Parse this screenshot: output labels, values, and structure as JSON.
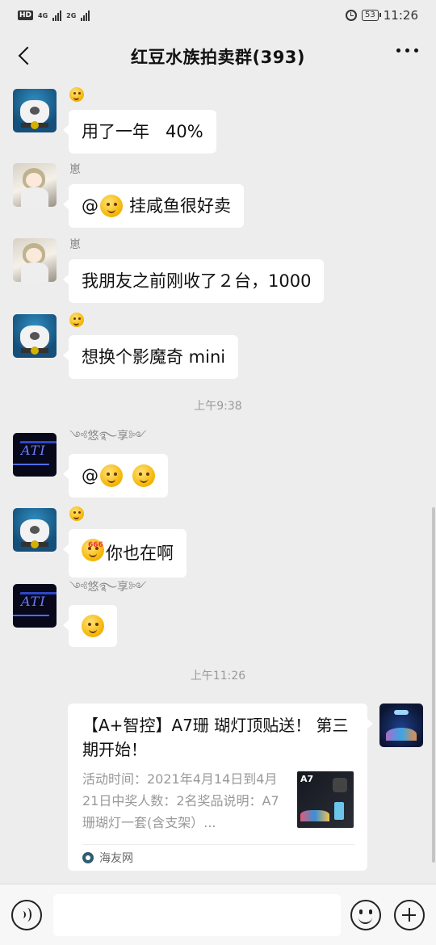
{
  "status_bar": {
    "network_badge": "HD",
    "signal1_label": "4G",
    "signal2_label": "2G",
    "battery": "53",
    "time": "11:26"
  },
  "header": {
    "title": "红豆水族拍卖群(393)"
  },
  "messages": [
    {
      "sender_icon": "thinking-emoji",
      "text": "用了一年   40%"
    },
    {
      "sender": "崽",
      "text": "挂咸鱼很好卖",
      "prefix": "@"
    },
    {
      "sender": "崽",
      "text": "我朋友之前刚收了２台，1000"
    },
    {
      "sender_icon": "thinking-emoji",
      "text": "想换个影魔奇 mini"
    },
    {
      "sender": "༺悠࿐享༻",
      "prefix": "@"
    },
    {
      "sender_icon": "thinking-emoji",
      "text": "你也在啊",
      "emoji_tag": "666"
    },
    {
      "sender": "༺悠࿐享༻"
    }
  ],
  "timestamps": [
    "上午9:38",
    "上午11:26"
  ],
  "avatar_text": {
    "aqua": "ATI"
  },
  "link_card": {
    "title": "【A+智控】A7珊 瑚灯顶贴送！ 第三期开始！",
    "description": "活动时间：2021年4月14日到4月21日中奖人数：2名奖品说明：A7珊瑚灯一套(含支架）...",
    "thumb_label": "A7",
    "source": "海友网"
  },
  "input": {
    "placeholder": ""
  },
  "colors": {
    "background": "#ededed",
    "bubble": "#ffffff",
    "timestamp": "#9a9a9a"
  }
}
